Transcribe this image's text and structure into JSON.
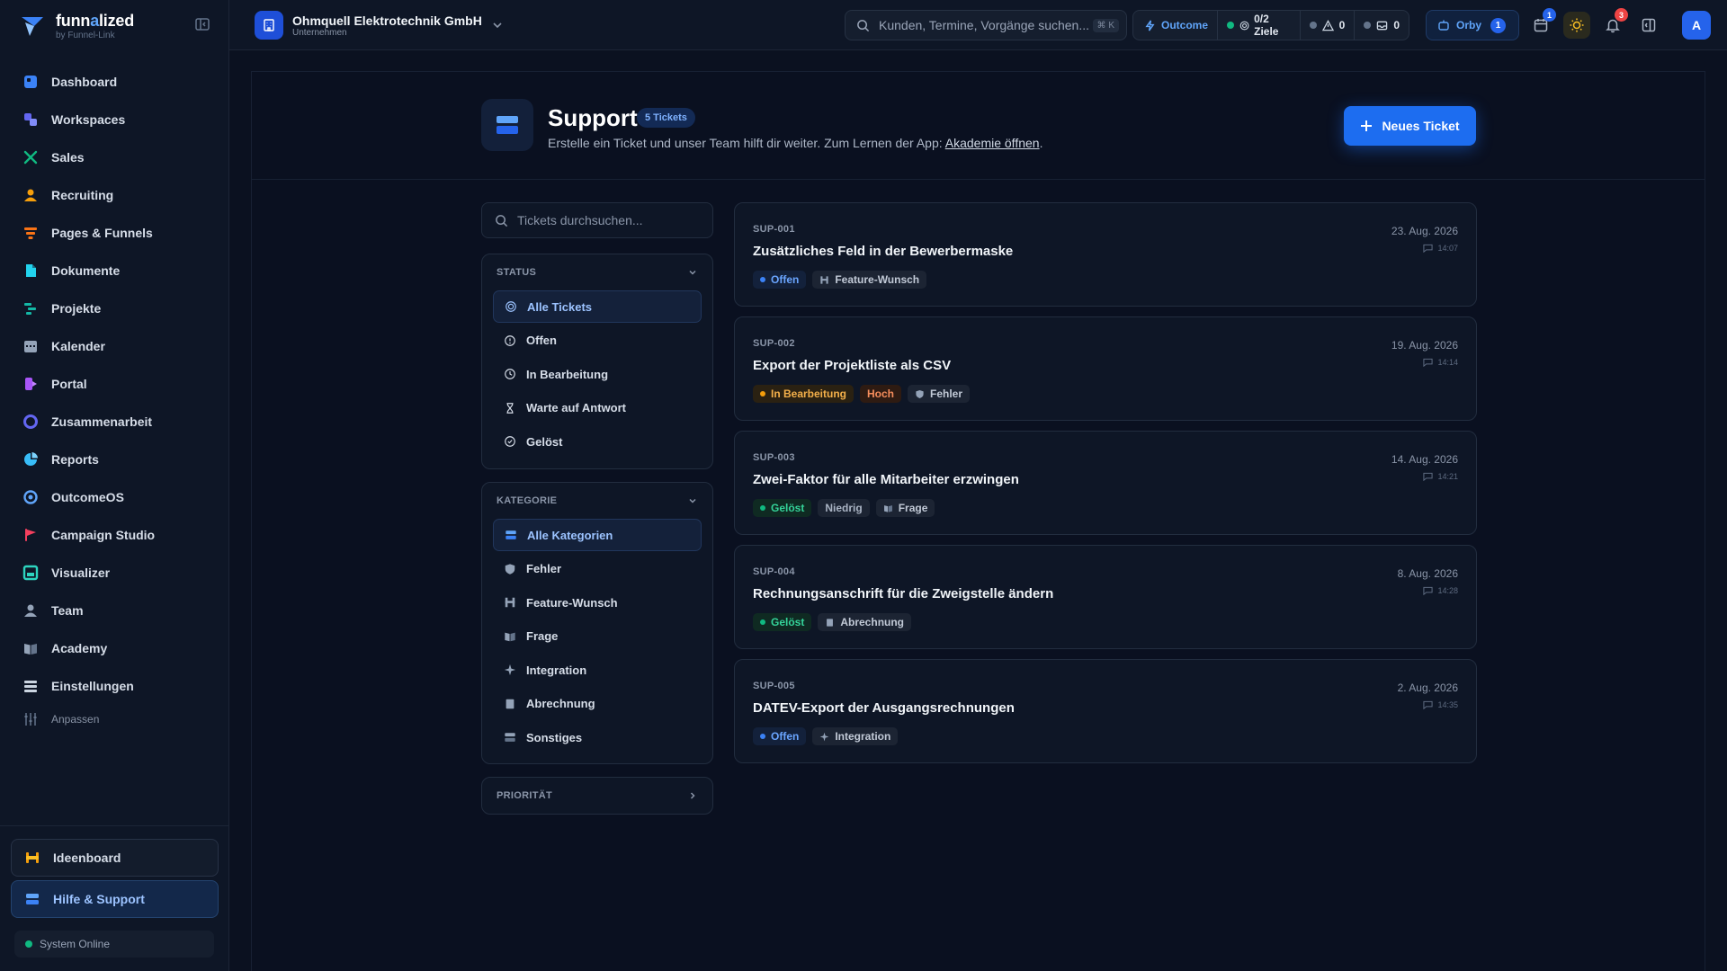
{
  "brand": {
    "name_part1": "funn",
    "name_highlight": "a",
    "name_part2": "lized",
    "sub": "by Funnel-Link"
  },
  "sidebar": {
    "items": [
      {
        "label": "Dashboard",
        "icon": "dashboard-icon",
        "color": "#3b82f6"
      },
      {
        "label": "Workspaces",
        "icon": "workspaces-icon",
        "color": "#6366f1"
      },
      {
        "label": "Sales",
        "icon": "sales-icon",
        "color": "#10b981"
      },
      {
        "label": "Recruiting",
        "icon": "recruiting-icon",
        "color": "#f59e0b"
      },
      {
        "label": "Pages & Funnels",
        "icon": "funnel-icon",
        "color": "#f97316"
      },
      {
        "label": "Dokumente",
        "icon": "documents-icon",
        "color": "#22d3ee"
      },
      {
        "label": "Projekte",
        "icon": "projects-icon",
        "color": "#14b8a6"
      },
      {
        "label": "Kalender",
        "icon": "calendar-icon",
        "color": "#94a3b8"
      },
      {
        "label": "Portal",
        "icon": "portal-icon",
        "color": "#a855f7"
      },
      {
        "label": "Zusammenarbeit",
        "icon": "collaboration-icon",
        "color": "#6366f1"
      },
      {
        "label": "Reports",
        "icon": "reports-icon",
        "color": "#38bdf8"
      },
      {
        "label": "OutcomeOS",
        "icon": "outcomeos-icon",
        "color": "#60a5fa"
      },
      {
        "label": "Campaign Studio",
        "icon": "flag-icon",
        "color": "#f43f5e"
      },
      {
        "label": "Visualizer",
        "icon": "visualizer-icon",
        "color": "#2dd4bf"
      },
      {
        "label": "Team",
        "icon": "team-icon",
        "color": "#94a3b8"
      },
      {
        "label": "Academy",
        "icon": "academy-icon",
        "color": "#94a3b8"
      },
      {
        "label": "Einstellungen",
        "icon": "settings-icon",
        "color": "#cbd5e1"
      }
    ],
    "customize_label": "Anpassen",
    "ideaboard_label": "Ideenboard",
    "help_label": "Hilfe & Support",
    "system_status": "System Online"
  },
  "header": {
    "company_name": "Ohmquell Elektrotechnik GmbH",
    "company_type": "Unternehmen",
    "search_placeholder": "Kunden, Termine, Vorgänge suchen...",
    "search_shortcut": "⌘ K",
    "outcome_label": "Outcome",
    "goals_label": "0/2 Ziele",
    "warnings_count": "0",
    "messages_count": "0",
    "orby_label": "Orby",
    "orby_count": "1",
    "calendar_badge": "1",
    "notifications_badge": "3",
    "avatar_initial": "A"
  },
  "page": {
    "title": "Support",
    "ticket_count": "5 Tickets",
    "description": "Erstelle ein Ticket und unser Team hilft dir weiter. Zum Lernen der App: ",
    "academy_link": "Akademie öffnen",
    "description_end": ".",
    "new_ticket_label": "Neues Ticket"
  },
  "filters": {
    "search_placeholder": "Tickets durchsuchen...",
    "status_title": "STATUS",
    "status_items": [
      "Alle Tickets",
      "Offen",
      "In Bearbeitung",
      "Warte auf Antwort",
      "Gelöst"
    ],
    "category_title": "KATEGORIE",
    "category_items": [
      "Alle Kategorien",
      "Fehler",
      "Feature-Wunsch",
      "Frage",
      "Integration",
      "Abrechnung",
      "Sonstiges"
    ],
    "priority_title": "PRIORITÄT"
  },
  "tickets": [
    {
      "id": "SUP-001",
      "title": "Zusätzliches Feld in der Bewerbermaske",
      "date": "23. Aug. 2026",
      "time": "14:07",
      "status": "Offen",
      "priority": "",
      "category": "Feature-Wunsch"
    },
    {
      "id": "SUP-002",
      "title": "Export der Projektliste als CSV",
      "date": "19. Aug. 2026",
      "time": "14:14",
      "status": "In Bearbeitung",
      "priority": "Hoch",
      "category": "Fehler"
    },
    {
      "id": "SUP-003",
      "title": "Zwei-Faktor für alle Mitarbeiter erzwingen",
      "date": "14. Aug. 2026",
      "time": "14:21",
      "status": "Gelöst",
      "priority": "Niedrig",
      "category": "Frage"
    },
    {
      "id": "SUP-004",
      "title": "Rechnungsanschrift für die Zweigstelle ändern",
      "date": "8. Aug. 2026",
      "time": "14:28",
      "status": "Gelöst",
      "priority": "",
      "category": "Abrechnung"
    },
    {
      "id": "SUP-005",
      "title": "DATEV-Export der Ausgangsrechnungen",
      "date": "2. Aug. 2026",
      "time": "14:35",
      "status": "Offen",
      "priority": "",
      "category": "Integration"
    }
  ]
}
